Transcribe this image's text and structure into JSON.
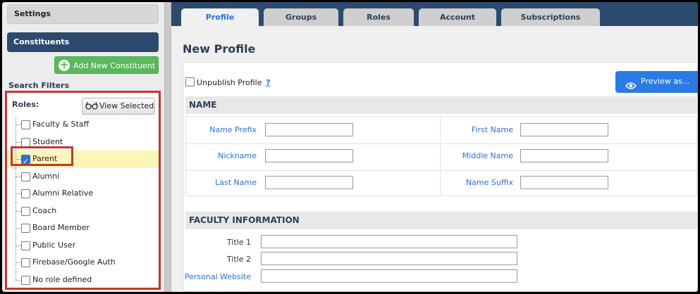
{
  "sidebar": {
    "settings_label": "Settings",
    "constituents_label": "Constituents",
    "add_button_label": "Add New Constituent",
    "search_filters_label": "Search Filters",
    "roles_label": "Roles:",
    "view_selected_label": "View Selected",
    "roles": [
      {
        "label": "Faculty & Staff",
        "checked": false
      },
      {
        "label": "Student",
        "checked": false
      },
      {
        "label": "Parent",
        "checked": true
      },
      {
        "label": "Alumni",
        "checked": false
      },
      {
        "label": "Alumni Relative",
        "checked": false
      },
      {
        "label": "Coach",
        "checked": false
      },
      {
        "label": "Board Member",
        "checked": false
      },
      {
        "label": "Public User",
        "checked": false
      },
      {
        "label": "Firebase/Google Auth",
        "checked": false
      },
      {
        "label": "No role defined",
        "checked": false
      }
    ]
  },
  "tabs": [
    {
      "label": "Profile",
      "active": true
    },
    {
      "label": "Groups",
      "active": false
    },
    {
      "label": "Roles",
      "active": false
    },
    {
      "label": "Account",
      "active": false
    },
    {
      "label": "Subscriptions",
      "active": false
    }
  ],
  "main": {
    "page_title": "New Profile",
    "unpublish_label": "Unpublish Profile",
    "help_link": "?",
    "preview_label": "Preview as...",
    "name_section_title": "NAME",
    "name_fields": {
      "prefix": {
        "label": "Name Prefix",
        "value": ""
      },
      "first": {
        "label": "First Name",
        "value": ""
      },
      "nickname": {
        "label": "Nickname",
        "value": ""
      },
      "middle": {
        "label": "Middle Name",
        "value": ""
      },
      "last": {
        "label": "Last Name",
        "value": ""
      },
      "suffix": {
        "label": "Name Suffix",
        "value": ""
      }
    },
    "faculty_section_title": "FACULTY INFORMATION",
    "faculty_fields": {
      "title1": {
        "label": "Title 1",
        "value": ""
      },
      "title2": {
        "label": "Title 2",
        "value": ""
      },
      "website": {
        "label": "Personal Website",
        "value": ""
      }
    }
  },
  "colors": {
    "nav_dark": "#2c4a6e",
    "accent_blue": "#2a7be4",
    "add_green": "#5cb85c",
    "highlight_red": "#c0392b",
    "selected_row": "#fdf6b8"
  }
}
